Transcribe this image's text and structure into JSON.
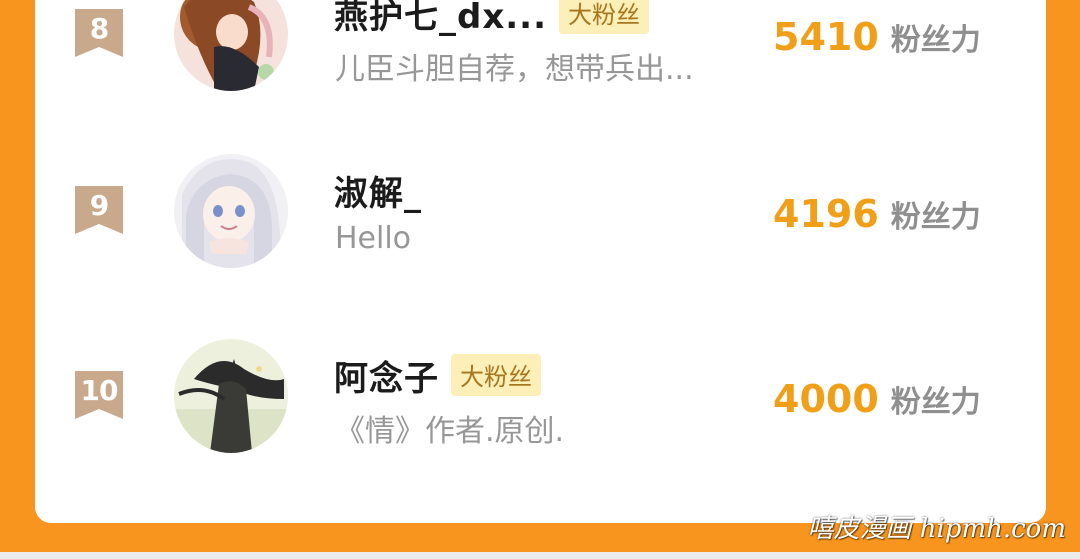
{
  "leaderboard": {
    "unit_label": "粉丝力",
    "badge_label": "大粉丝",
    "entries": [
      {
        "rank": "8",
        "name": "燕护七_dx...",
        "has_badge": true,
        "bio": "儿臣斗胆自荐，想带兵出...",
        "score": "5410"
      },
      {
        "rank": "9",
        "name": "淑解_",
        "has_badge": false,
        "bio": "Hello",
        "score": "4196"
      },
      {
        "rank": "10",
        "name": "阿念子",
        "has_badge": true,
        "bio": "《情》作者.原创.",
        "score": "4000"
      }
    ]
  },
  "watermark": "嘻皮漫画 hipmh.com",
  "colors": {
    "frame": "#F7951E",
    "score": "#F19F18",
    "badge_bg": "#FCEFB7",
    "badge_text": "#A9761E",
    "rank_badge": "#C9A98C"
  },
  "icons": {
    "rank_marker": "ribbon-bookmark-icon"
  }
}
